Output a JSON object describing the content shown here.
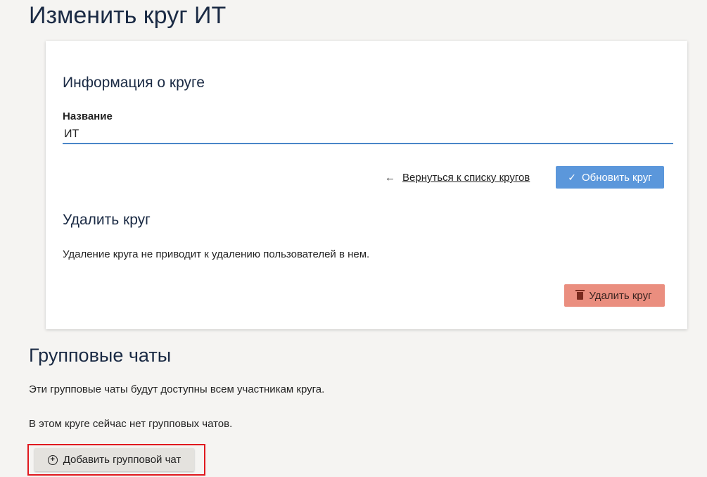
{
  "page": {
    "title": "Изменить круг ИТ"
  },
  "circle_info": {
    "heading": "Информация о круге",
    "name_label": "Название",
    "name_value": "ИТ",
    "back_link": "Вернуться к списку кругов",
    "back_icon": "arrow-left-icon",
    "update_button": "Обновить круг",
    "update_icon": "check-icon"
  },
  "delete_circle": {
    "heading": "Удалить круг",
    "description": "Удаление круга не приводит к удалению пользователей в нем.",
    "delete_button": "Удалить круг",
    "delete_icon": "trash-icon"
  },
  "group_chats": {
    "heading": "Групповые чаты",
    "description": "Эти групповые чаты будут доступны всем участникам круга.",
    "empty_text": "В этом круге сейчас нет групповых чатов.",
    "add_button": "Добавить групповой чат",
    "add_icon": "plus-circle-icon"
  },
  "colors": {
    "primary": "#5b97db",
    "danger": "#ea8e7f",
    "highlight": "#e0181e",
    "title": "#1a2a44"
  }
}
